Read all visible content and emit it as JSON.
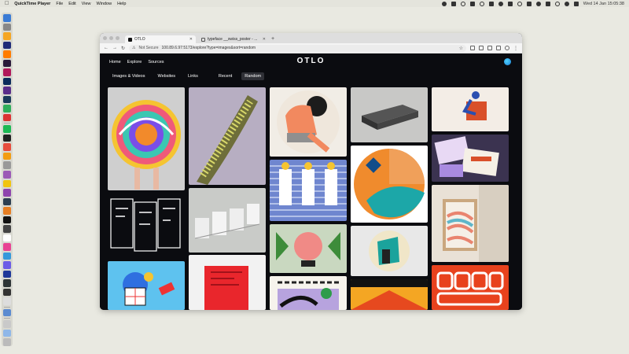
{
  "menubar": {
    "app_name": "QuickTime Player",
    "menus": [
      "File",
      "Edit",
      "View",
      "Window",
      "Help"
    ],
    "clock": "Wed 14 Jan 15:05:38"
  },
  "browser": {
    "tabs": [
      {
        "label": "OTLO",
        "active": true
      },
      {
        "label": "typeface __swiss_poster - ..."
      }
    ],
    "new_tab": "+",
    "security_label": "Not Secure",
    "url": "100.89.6.97:5173/explore?type=images&sort=random"
  },
  "site": {
    "logo": "OTLO",
    "nav": [
      "Home",
      "Explore",
      "Sources"
    ],
    "type_filters": [
      "Images & Videos",
      "Websites",
      "Links"
    ],
    "sort_filters": [
      "Recent",
      "Random"
    ],
    "active_sort": "Random"
  },
  "colors": {
    "background": "#0b0c10",
    "chip_active": "#2f3036",
    "desktop": "#e9e9e1"
  }
}
